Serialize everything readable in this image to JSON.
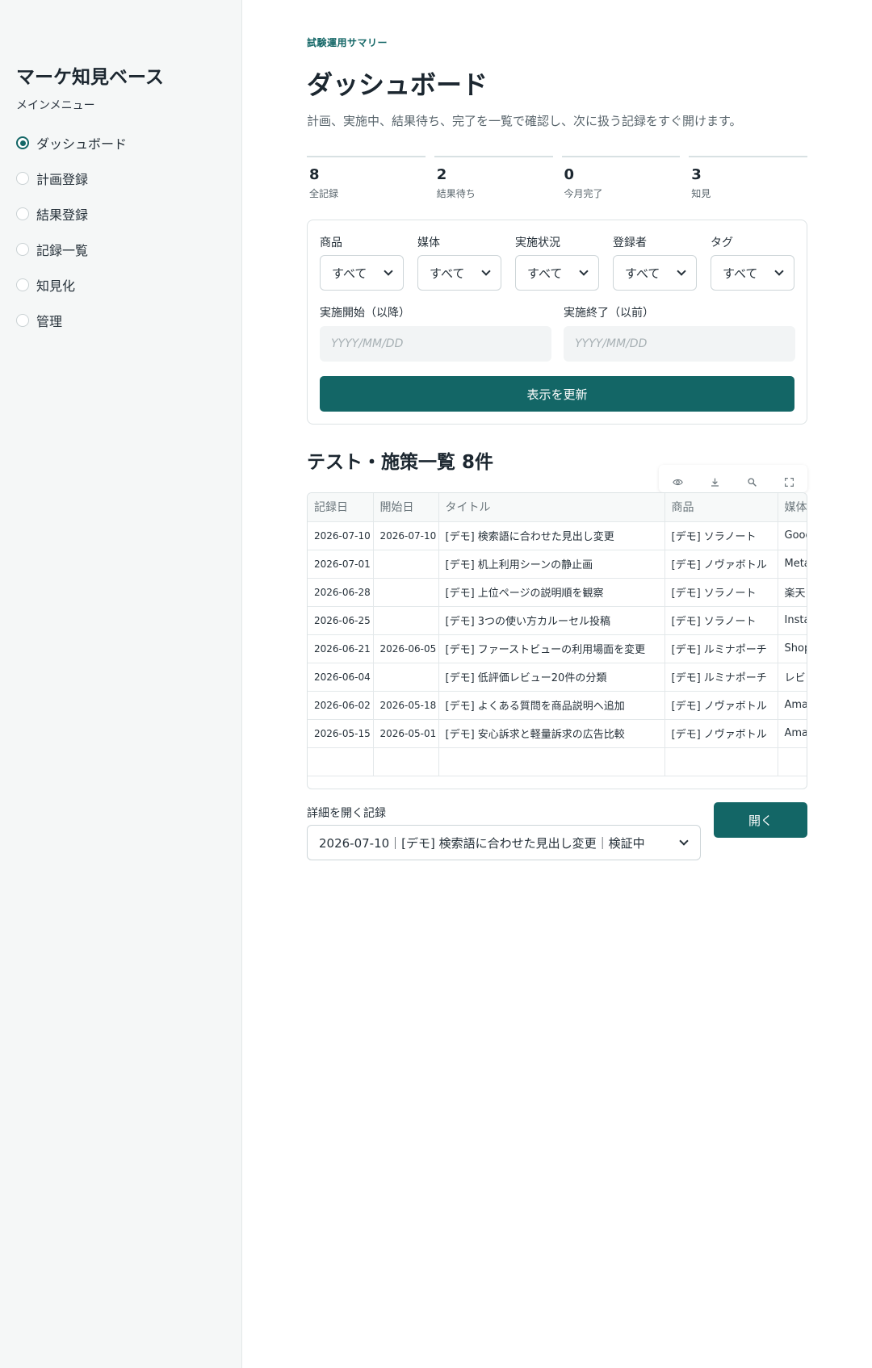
{
  "sidebar": {
    "app_title": "マーケ知見ベース",
    "menu_heading": "メインメニュー",
    "items": [
      {
        "label": "ダッシュボード",
        "selected": true
      },
      {
        "label": "計画登録",
        "selected": false
      },
      {
        "label": "結果登録",
        "selected": false
      },
      {
        "label": "記録一覧",
        "selected": false
      },
      {
        "label": "知見化",
        "selected": false
      },
      {
        "label": "管理",
        "selected": false
      }
    ]
  },
  "header": {
    "eyebrow": "試験運用サマリー",
    "title": "ダッシュボード",
    "description": "計画、実施中、結果待ち、完了を一覧で確認し、次に扱う記録をすぐ開けます。"
  },
  "stats": [
    {
      "value": "8",
      "label": "全記録"
    },
    {
      "value": "2",
      "label": "結果待ち"
    },
    {
      "value": "0",
      "label": "今月完了"
    },
    {
      "value": "3",
      "label": "知見"
    }
  ],
  "filters": {
    "product": {
      "label": "商品",
      "value": "すべて"
    },
    "media": {
      "label": "媒体",
      "value": "すべて"
    },
    "status": {
      "label": "実施状況",
      "value": "すべて"
    },
    "registrant": {
      "label": "登録者",
      "value": "すべて"
    },
    "tag": {
      "label": "タグ",
      "value": "すべて"
    },
    "start_date": {
      "label": "実施開始（以降）",
      "placeholder": "YYYY/MM/DD"
    },
    "end_date": {
      "label": "実施終了（以前）",
      "placeholder": "YYYY/MM/DD"
    },
    "refresh_label": "表示を更新"
  },
  "list": {
    "title": "テスト・施策一覧 8件",
    "columns": [
      "記録日",
      "開始日",
      "タイトル",
      "商品",
      "媒体"
    ],
    "rows": [
      [
        "2026-07-10",
        "2026-07-10",
        "[デモ] 検索語に合わせた見出し変更",
        "[デモ] ソラノート",
        "Google"
      ],
      [
        "2026-07-01",
        "",
        "[デモ] 机上利用シーンの静止画",
        "[デモ] ノヴァボトル",
        "Meta"
      ],
      [
        "2026-06-28",
        "",
        "[デモ] 上位ページの説明順を観察",
        "[デモ] ソラノート",
        "楽天"
      ],
      [
        "2026-06-25",
        "",
        "[デモ] 3つの使い方カルーセル投稿",
        "[デモ] ソラノート",
        "Instagram"
      ],
      [
        "2026-06-21",
        "2026-06-05",
        "[デモ] ファーストビューの利用場面を変更",
        "[デモ] ルミナポーチ",
        "Shopify"
      ],
      [
        "2026-06-04",
        "",
        "[デモ] 低評価レビュー20件の分類",
        "[デモ] ルミナポーチ",
        "レビュー"
      ],
      [
        "2026-06-02",
        "2026-05-18",
        "[デモ] よくある質問を商品説明へ追加",
        "[デモ] ノヴァボトル",
        "Amazon"
      ],
      [
        "2026-05-15",
        "2026-05-01",
        "[デモ] 安心訴求と軽量訴求の広告比較",
        "[デモ] ノヴァボトル",
        "Amazon"
      ],
      [
        "",
        "",
        "",
        "",
        ""
      ]
    ]
  },
  "detail": {
    "label": "詳細を開く記録",
    "selected": "2026-07-10｜[デモ] 検索語に合わせた見出し変更｜検証中",
    "open_label": "開く"
  },
  "icons": [
    "radio-icon",
    "chevron-down-icon",
    "eye-icon",
    "download-icon",
    "search-icon",
    "fullscreen-icon"
  ],
  "colors": {
    "accent": "#136666",
    "sidebar_bg": "#f5f7f7"
  }
}
